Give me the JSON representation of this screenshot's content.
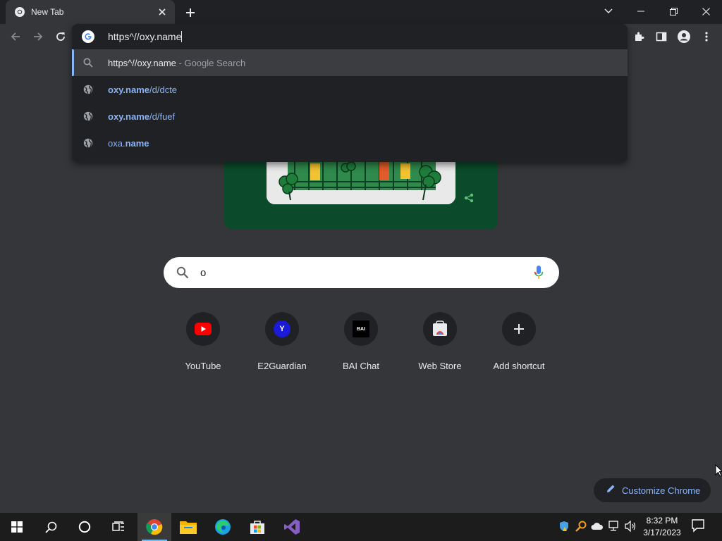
{
  "tab": {
    "title": "New Tab"
  },
  "omnibox": {
    "input_value": "https^//oxy.name",
    "suggestions": [
      {
        "main": "https^//oxy.name",
        "sep": " - ",
        "secondary": "Google Search"
      },
      {
        "bold": "oxy.name",
        "rest": "/d/dcte"
      },
      {
        "bold": "oxy.name",
        "rest": "/d/fuef"
      },
      {
        "pre": "oxa.",
        "bold": "name"
      }
    ]
  },
  "search": {
    "value": "o"
  },
  "shortcuts": [
    {
      "label": "YouTube",
      "icon": "youtube-icon"
    },
    {
      "label": "E2Guardian",
      "icon": "y-letter-icon",
      "letter": "Y"
    },
    {
      "label": "BAI Chat",
      "icon": "bai-icon",
      "letter": "BAI"
    },
    {
      "label": "Web Store",
      "icon": "web-store-icon"
    },
    {
      "label": "Add shortcut",
      "icon": "plus-icon"
    }
  ],
  "customize": {
    "label": "Customize Chrome"
  },
  "clock": {
    "time": "8:32 PM",
    "date": "3/17/2023"
  },
  "colors": {
    "accent": "#8ab4f8",
    "page_bg": "#35363a",
    "taskbar": "#1c1c1c"
  }
}
